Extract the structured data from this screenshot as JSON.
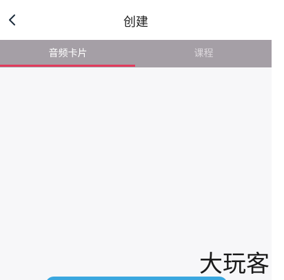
{
  "header": {
    "title": "创建",
    "back_icon": "chevron-left-icon"
  },
  "tabs": [
    {
      "label": "音频卡片",
      "active": true
    },
    {
      "label": "课程",
      "active": false
    }
  ],
  "colors": {
    "tab_bar_bg": "#a59fa6",
    "tab_indicator": "#e23b5d",
    "content_bg": "#f7f7f9",
    "primary_button": "#3aa7df"
  },
  "watermark": {
    "text": "大玩客"
  }
}
